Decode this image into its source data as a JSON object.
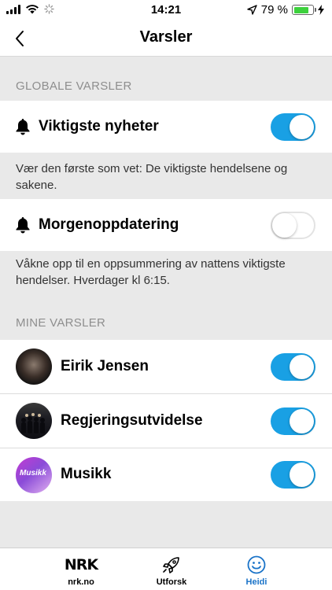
{
  "status_bar": {
    "time": "14:21",
    "battery_text": "79 %",
    "battery_level": 0.79
  },
  "nav": {
    "title": "Varsler"
  },
  "sections": {
    "global_header": "GLOBALE VARSLER",
    "mine_header": "MINE VARSLER"
  },
  "global_alerts": [
    {
      "label": "Viktigste nyheter",
      "enabled": true,
      "description": "Vær den første som vet: De viktigste hendelsene og sakene."
    },
    {
      "label": "Morgenoppdatering",
      "enabled": false,
      "description": "Våkne opp til en oppsummering av nattens viktigste hendelser. Hverdager kl 6:15."
    }
  ],
  "my_alerts": [
    {
      "label": "Eirik Jensen",
      "enabled": true
    },
    {
      "label": "Regjeringsutvidelse",
      "enabled": true
    },
    {
      "label": "Musikk",
      "enabled": true,
      "avatar_text": "Musikk"
    }
  ],
  "tabs": [
    {
      "label": "nrk.no",
      "icon": "nrk-logo-icon",
      "logo_text": "NRK"
    },
    {
      "label": "Utforsk",
      "icon": "rocket-icon"
    },
    {
      "label": "Heidi",
      "icon": "smiley-icon",
      "active": true
    }
  ],
  "colors": {
    "toggle_on": "#19a0e4",
    "accent_tab": "#1a73c8",
    "background": "#e9e9e9"
  }
}
